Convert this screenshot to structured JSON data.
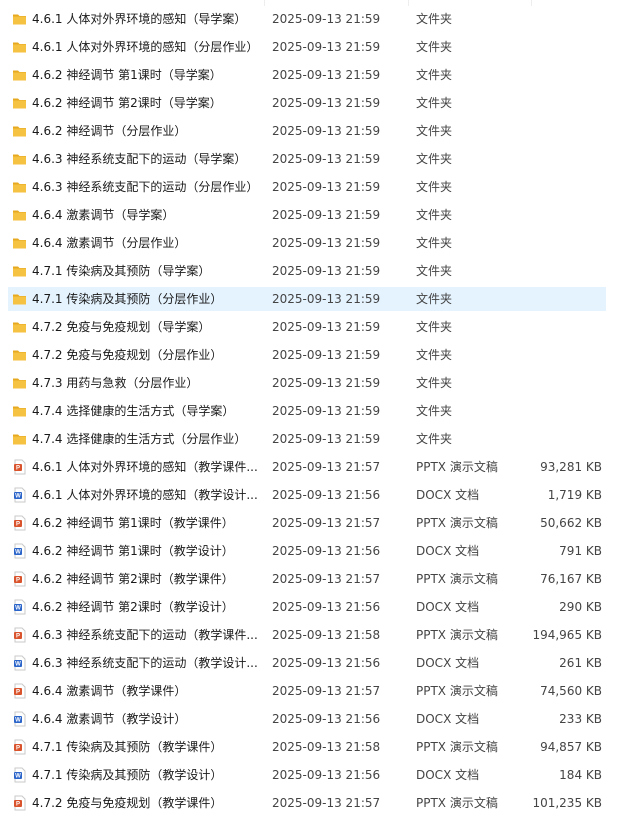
{
  "files": [
    {
      "name": "4.6.1 人体对外界环境的感知（导学案）",
      "modified": "2025-09-13 21:59",
      "type": "文件夹",
      "size": "",
      "icon": "folder-icon"
    },
    {
      "name": "4.6.1 人体对外界环境的感知（分层作业）",
      "modified": "2025-09-13 21:59",
      "type": "文件夹",
      "size": "",
      "icon": "folder-icon"
    },
    {
      "name": "4.6.2 神经调节 第1课时（导学案）",
      "modified": "2025-09-13 21:59",
      "type": "文件夹",
      "size": "",
      "icon": "folder-icon"
    },
    {
      "name": "4.6.2 神经调节 第2课时（导学案）",
      "modified": "2025-09-13 21:59",
      "type": "文件夹",
      "size": "",
      "icon": "folder-icon"
    },
    {
      "name": "4.6.2 神经调节（分层作业）",
      "modified": "2025-09-13 21:59",
      "type": "文件夹",
      "size": "",
      "icon": "folder-icon"
    },
    {
      "name": "4.6.3 神经系统支配下的运动（导学案）",
      "modified": "2025-09-13 21:59",
      "type": "文件夹",
      "size": "",
      "icon": "folder-icon"
    },
    {
      "name": "4.6.3 神经系统支配下的运动（分层作业）",
      "modified": "2025-09-13 21:59",
      "type": "文件夹",
      "size": "",
      "icon": "folder-icon"
    },
    {
      "name": "4.6.4 激素调节（导学案）",
      "modified": "2025-09-13 21:59",
      "type": "文件夹",
      "size": "",
      "icon": "folder-icon"
    },
    {
      "name": "4.6.4 激素调节（分层作业）",
      "modified": "2025-09-13 21:59",
      "type": "文件夹",
      "size": "",
      "icon": "folder-icon"
    },
    {
      "name": "4.7.1 传染病及其预防（导学案）",
      "modified": "2025-09-13 21:59",
      "type": "文件夹",
      "size": "",
      "icon": "folder-icon"
    },
    {
      "name": "4.7.1 传染病及其预防（分层作业）",
      "modified": "2025-09-13 21:59",
      "type": "文件夹",
      "size": "",
      "icon": "folder-icon",
      "selected": true
    },
    {
      "name": "4.7.2 免疫与免疫规划（导学案）",
      "modified": "2025-09-13 21:59",
      "type": "文件夹",
      "size": "",
      "icon": "folder-icon"
    },
    {
      "name": "4.7.2 免疫与免疫规划（分层作业）",
      "modified": "2025-09-13 21:59",
      "type": "文件夹",
      "size": "",
      "icon": "folder-icon"
    },
    {
      "name": "4.7.3 用药与急救（分层作业）",
      "modified": "2025-09-13 21:59",
      "type": "文件夹",
      "size": "",
      "icon": "folder-icon"
    },
    {
      "name": "4.7.4 选择健康的生活方式（导学案）",
      "modified": "2025-09-13 21:59",
      "type": "文件夹",
      "size": "",
      "icon": "folder-icon"
    },
    {
      "name": "4.7.4 选择健康的生活方式（分层作业）",
      "modified": "2025-09-13 21:59",
      "type": "文件夹",
      "size": "",
      "icon": "folder-icon"
    },
    {
      "name": "4.6.1 人体对外界环境的感知（教学课件...",
      "modified": "2025-09-13 21:57",
      "type": "PPTX 演示文稿",
      "size": "93,281 KB",
      "icon": "pptx-icon"
    },
    {
      "name": "4.6.1 人体对外界环境的感知（教学设计...",
      "modified": "2025-09-13 21:56",
      "type": "DOCX 文档",
      "size": "1,719 KB",
      "icon": "docx-icon"
    },
    {
      "name": "4.6.2 神经调节 第1课时（教学课件）",
      "modified": "2025-09-13 21:57",
      "type": "PPTX 演示文稿",
      "size": "50,662 KB",
      "icon": "pptx-icon"
    },
    {
      "name": "4.6.2 神经调节 第1课时（教学设计）",
      "modified": "2025-09-13 21:56",
      "type": "DOCX 文档",
      "size": "791 KB",
      "icon": "docx-icon"
    },
    {
      "name": "4.6.2 神经调节 第2课时（教学课件）",
      "modified": "2025-09-13 21:57",
      "type": "PPTX 演示文稿",
      "size": "76,167 KB",
      "icon": "pptx-icon"
    },
    {
      "name": "4.6.2 神经调节 第2课时（教学设计）",
      "modified": "2025-09-13 21:56",
      "type": "DOCX 文档",
      "size": "290 KB",
      "icon": "docx-icon"
    },
    {
      "name": "4.6.3 神经系统支配下的运动（教学课件...",
      "modified": "2025-09-13 21:58",
      "type": "PPTX 演示文稿",
      "size": "194,965 KB",
      "icon": "pptx-icon"
    },
    {
      "name": "4.6.3 神经系统支配下的运动（教学设计...",
      "modified": "2025-09-13 21:56",
      "type": "DOCX 文档",
      "size": "261 KB",
      "icon": "docx-icon"
    },
    {
      "name": "4.6.4 激素调节（教学课件）",
      "modified": "2025-09-13 21:57",
      "type": "PPTX 演示文稿",
      "size": "74,560 KB",
      "icon": "pptx-icon"
    },
    {
      "name": "4.6.4 激素调节（教学设计）",
      "modified": "2025-09-13 21:56",
      "type": "DOCX 文档",
      "size": "233 KB",
      "icon": "docx-icon"
    },
    {
      "name": "4.7.1 传染病及其预防（教学课件）",
      "modified": "2025-09-13 21:58",
      "type": "PPTX 演示文稿",
      "size": "94,857 KB",
      "icon": "pptx-icon"
    },
    {
      "name": "4.7.1 传染病及其预防（教学设计）",
      "modified": "2025-09-13 21:56",
      "type": "DOCX 文档",
      "size": "184 KB",
      "icon": "docx-icon"
    },
    {
      "name": "4.7.2 免疫与免疫规划（教学课件）",
      "modified": "2025-09-13 21:57",
      "type": "PPTX 演示文稿",
      "size": "101,235 KB",
      "icon": "pptx-icon"
    }
  ],
  "colors": {
    "folder": "#f5c242",
    "pptx": "#d9542c",
    "docx": "#2b65c9",
    "selection": "#e5f3ff"
  }
}
